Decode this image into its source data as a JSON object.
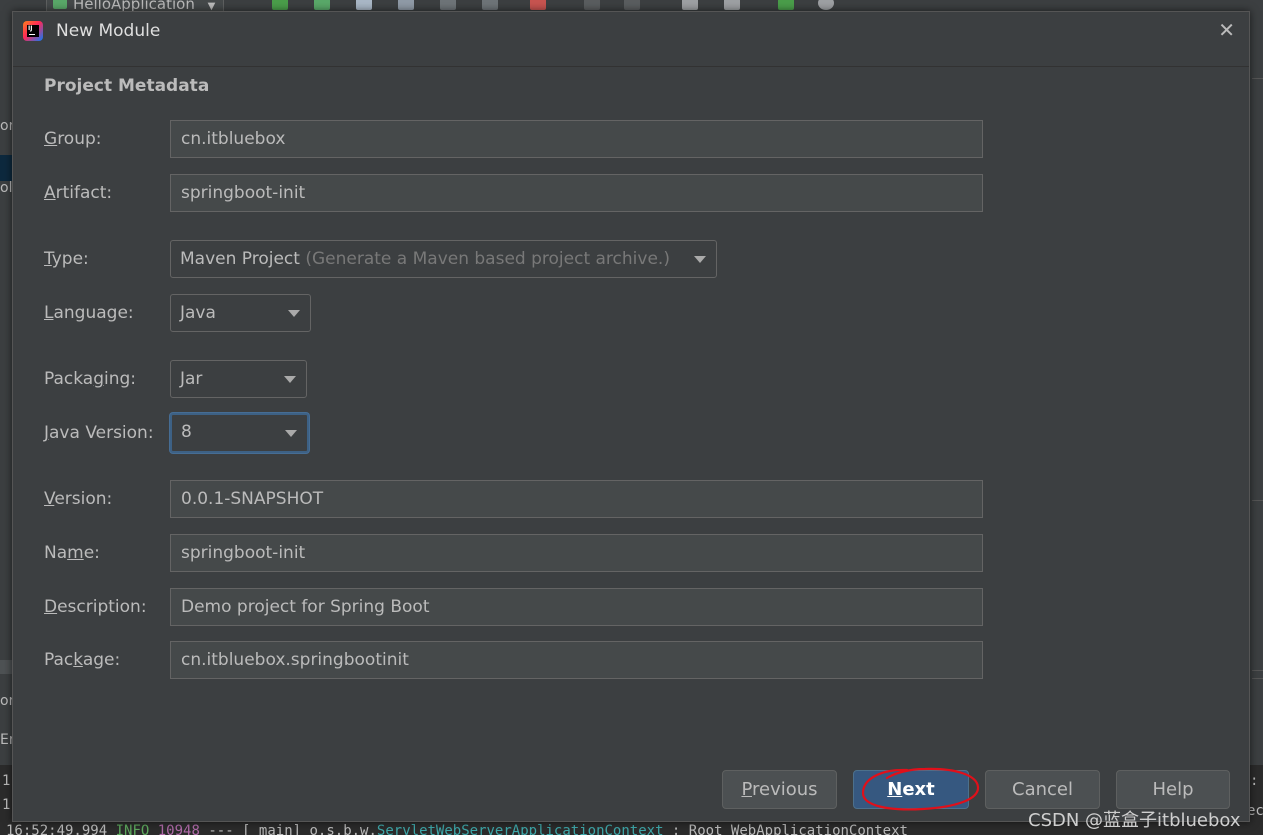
{
  "background": {
    "run_config_label": "HelloApplication",
    "left_fragments": [
      "or",
      "ol",
      "or",
      "Er"
    ],
    "console_line_numbers": [
      "1",
      "1"
    ],
    "console_log": {
      "time": "16:52:49.994",
      "level": "INFO",
      "pid": "10948",
      "middle": " --- [           main] o.s.b.w.",
      "cls": "ServletWebServerApplicationContext",
      "rest": " : Root WebApplicationContext"
    },
    "right_fragments": [
      ":",
      "ec"
    ]
  },
  "dialog": {
    "title": "New Module",
    "close_symbol": "✕",
    "section_title": "Project Metadata"
  },
  "fields": {
    "group": {
      "label_pre": "",
      "label_mn": "G",
      "label_post": "roup:",
      "value": "cn.itbluebox"
    },
    "artifact": {
      "label_pre": "",
      "label_mn": "A",
      "label_post": "rtifact:",
      "value": "springboot-init"
    },
    "type": {
      "label_pre": "",
      "label_mn": "T",
      "label_post": "ype:",
      "value": "Maven Project",
      "hint": " (Generate a Maven based project archive.)"
    },
    "language": {
      "label_pre": "",
      "label_mn": "L",
      "label_post": "anguage:",
      "value": "Java"
    },
    "packaging": {
      "label_pre": "Packa",
      "label_mn": "g",
      "label_post": "ing:",
      "value": "Jar"
    },
    "java_version": {
      "label_pre": "",
      "label_mn": "J",
      "label_post": "ava Version:",
      "value": "8"
    },
    "version": {
      "label_pre": "",
      "label_mn": "V",
      "label_post": "ersion:",
      "value": "0.0.1-SNAPSHOT"
    },
    "name": {
      "label_pre": "Na",
      "label_mn": "m",
      "label_post": "e:",
      "value": "springboot-init"
    },
    "description": {
      "label_pre": "",
      "label_mn": "D",
      "label_post": "escription:",
      "value": "Demo project for Spring Boot"
    },
    "package": {
      "label_pre": "Pac",
      "label_mn": "k",
      "label_post": "age:",
      "value": "cn.itbluebox.springbootinit"
    }
  },
  "buttons": {
    "previous": {
      "mn": "P",
      "rest": "revious"
    },
    "next": {
      "mn": "N",
      "rest": "ext"
    },
    "cancel": {
      "label": "Cancel"
    },
    "help": {
      "label": "Help"
    }
  },
  "colors": {
    "dialog_bg": "#3c3f41",
    "field_bg": "#45494a",
    "primary_button": "#365880",
    "focus_ring": "#3d6185",
    "annotation_red": "#e0101a"
  },
  "watermark": "CSDN @蓝盒子itbluebox"
}
